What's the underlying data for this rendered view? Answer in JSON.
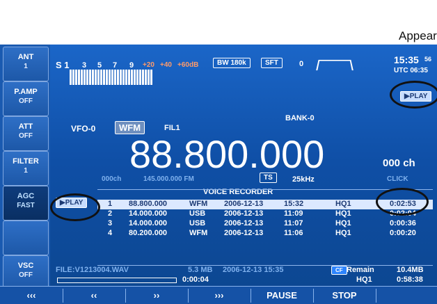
{
  "annotation": {
    "label": "Appear"
  },
  "sidebar": {
    "buttons": [
      {
        "title": "ANT",
        "value": "1"
      },
      {
        "title": "P.AMP",
        "value": "OFF"
      },
      {
        "title": "ATT",
        "value": "OFF"
      },
      {
        "title": "FILTER",
        "value": "1"
      },
      {
        "title": "AGC",
        "value": "FAST"
      },
      {
        "title": "",
        "value": ""
      },
      {
        "title": "VSC",
        "value": "OFF"
      }
    ]
  },
  "top": {
    "meter_label": "S 1",
    "scale": [
      "3",
      "5",
      "7",
      "9",
      "+20",
      "+40",
      "+60dB"
    ],
    "bw": "BW 180k",
    "sft": "SFT",
    "sft_value": "0",
    "time": "15:35",
    "time_seconds": "56",
    "utc": "UTC 06:35"
  },
  "vfo": {
    "label": "VFO-0",
    "mode": "WFM",
    "filter": "FIL1",
    "bank": "BANK-0",
    "frequency": "88.800.000",
    "unit": "000 ch",
    "sub_channel": "000ch",
    "sub_freq": "145.000.000 FM",
    "ts_label": "TS",
    "ts_value": "25kHz",
    "click": "CLICK"
  },
  "voice_recorder": {
    "title": "VOICE RECORDER",
    "play": "PLAY",
    "rows": [
      {
        "no": "1",
        "freq": "88.800.000",
        "mode": "WFM",
        "date": "2006-12-13",
        "time": "15:32",
        "q": "HQ1",
        "dur": "0:02:53"
      },
      {
        "no": "2",
        "freq": "14.000.000",
        "mode": "USB",
        "date": "2006-12-13",
        "time": "11:09",
        "q": "HQ1",
        "dur": "0:02:04"
      },
      {
        "no": "3",
        "freq": "14.000.000",
        "mode": "USB",
        "date": "2006-12-13",
        "time": "11:07",
        "q": "HQ1",
        "dur": "0:00:36"
      },
      {
        "no": "4",
        "freq": "80.200.000",
        "mode": "WFM",
        "date": "2006-12-13",
        "time": "11:06",
        "q": "HQ1",
        "dur": "0:00:20"
      }
    ],
    "file": "FILE:V1213004.WAV",
    "size": "5.3 MB",
    "file_date": "2006-12-13 15:35",
    "elapsed": "0:00:04",
    "cf": "CF",
    "remain_label": "Remain",
    "remain_size": "10.4MB",
    "remain_q": "HQ1",
    "remain_time": "0:58:38"
  },
  "bottom_bar": [
    "‹‹‹",
    "‹‹",
    "››",
    "›››",
    "PAUSE",
    "STOP"
  ]
}
